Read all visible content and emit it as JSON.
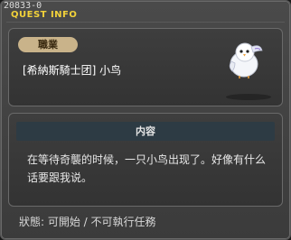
{
  "window": {
    "quest_id": "20833-0",
    "title": "QUEST INFO"
  },
  "info": {
    "job_label": "職業",
    "quest_name": "[希納斯騎士团] 小鸟",
    "npc_icon": "white-bird-icon"
  },
  "content": {
    "header": "内容",
    "text": "在等待奇襲的时候，一只小鸟出现了。好像有什么话要跟我说。"
  },
  "status": {
    "text": "狀態: 可開始 / 不可執行任務"
  },
  "colors": {
    "title": "#f2d23a",
    "badge": "#c9b38a",
    "header_bar": "#2d3b44"
  }
}
